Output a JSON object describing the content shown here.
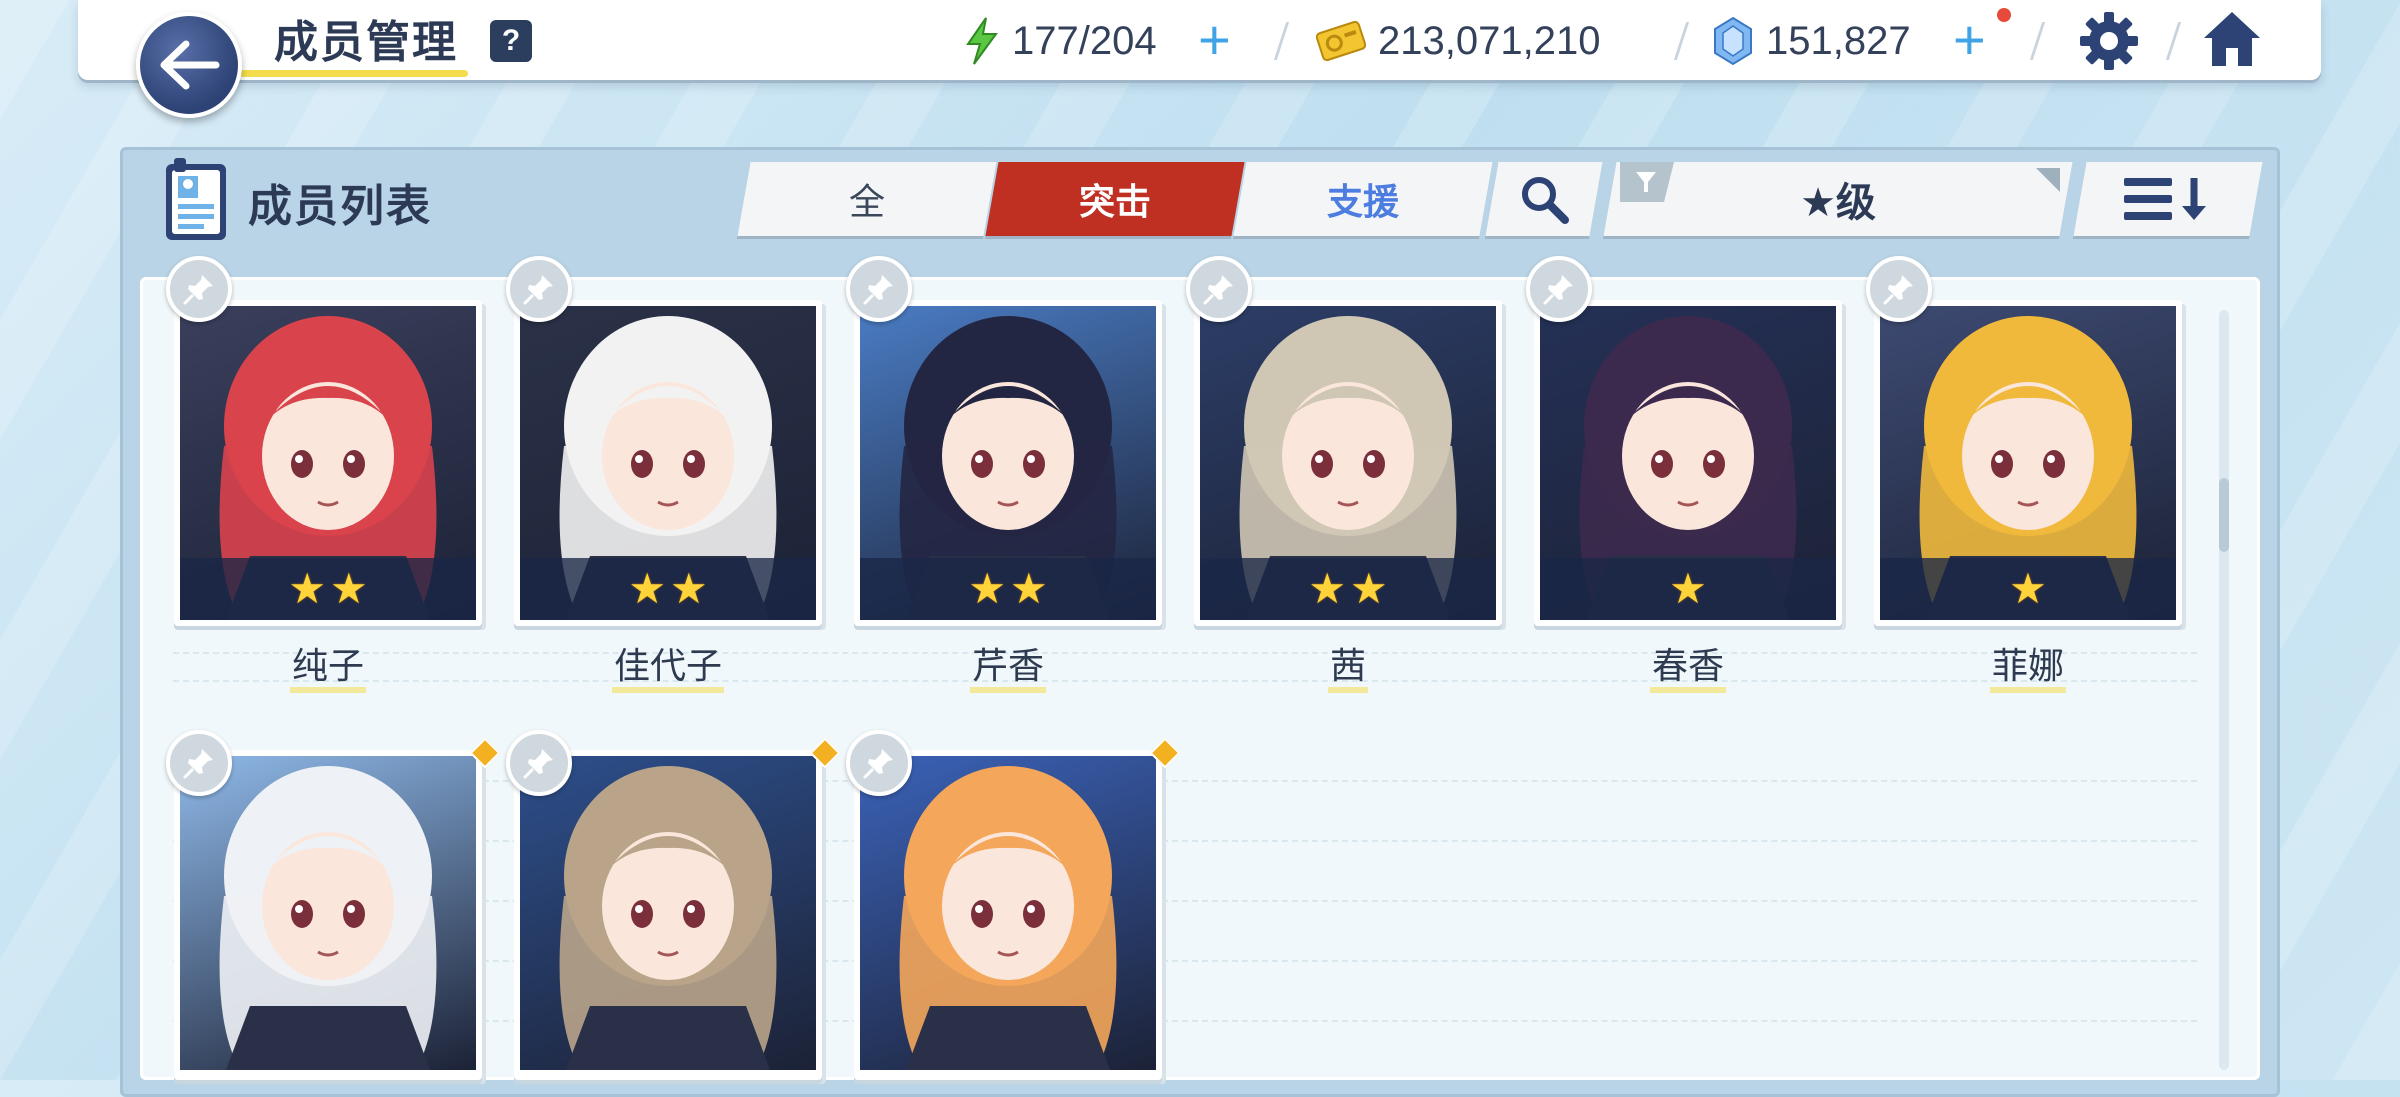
{
  "header": {
    "title": "成员管理",
    "help_label": "?",
    "ap": "177/204",
    "credits": "213,071,210",
    "pyroxene": "151,827"
  },
  "panel": {
    "title": "成员列表",
    "tabs": [
      {
        "label": "全",
        "active": false
      },
      {
        "label": "突击",
        "active": true
      },
      {
        "label": "支援",
        "active": false
      }
    ],
    "sort_label": "★级"
  },
  "students": [
    {
      "name": "纯子",
      "stars": 2,
      "hair": "#d9434c",
      "bg": "#3a3f5c"
    },
    {
      "name": "佳代子",
      "stars": 2,
      "hair": "#f2f2f2",
      "bg": "#2b3248"
    },
    {
      "name": "芹香",
      "stars": 2,
      "hair": "#232642",
      "bg": "#4a7cc4"
    },
    {
      "name": "茜",
      "stars": 2,
      "hair": "#cfc6b4",
      "bg": "#2c3d66"
    },
    {
      "name": "春香",
      "stars": 1,
      "hair": "#3c2a4e",
      "bg": "#243056"
    },
    {
      "name": "菲娜",
      "stars": 1,
      "hair": "#f0b93c",
      "bg": "#3d4a72"
    },
    {
      "name": "",
      "stars": 0,
      "hair": "#eef1f5",
      "bg": "#8fb9e8"
    },
    {
      "name": "",
      "stars": 0,
      "hair": "#b9a48a",
      "bg": "#2d4f8c"
    },
    {
      "name": "",
      "stars": 0,
      "hair": "#f4a65a",
      "bg": "#3b62b8"
    }
  ],
  "colors": {
    "accent_red": "#bf2f22",
    "support_blue": "#4d7de0",
    "star_gold": "#ffd43b",
    "nav_blue": "#2d4275"
  }
}
